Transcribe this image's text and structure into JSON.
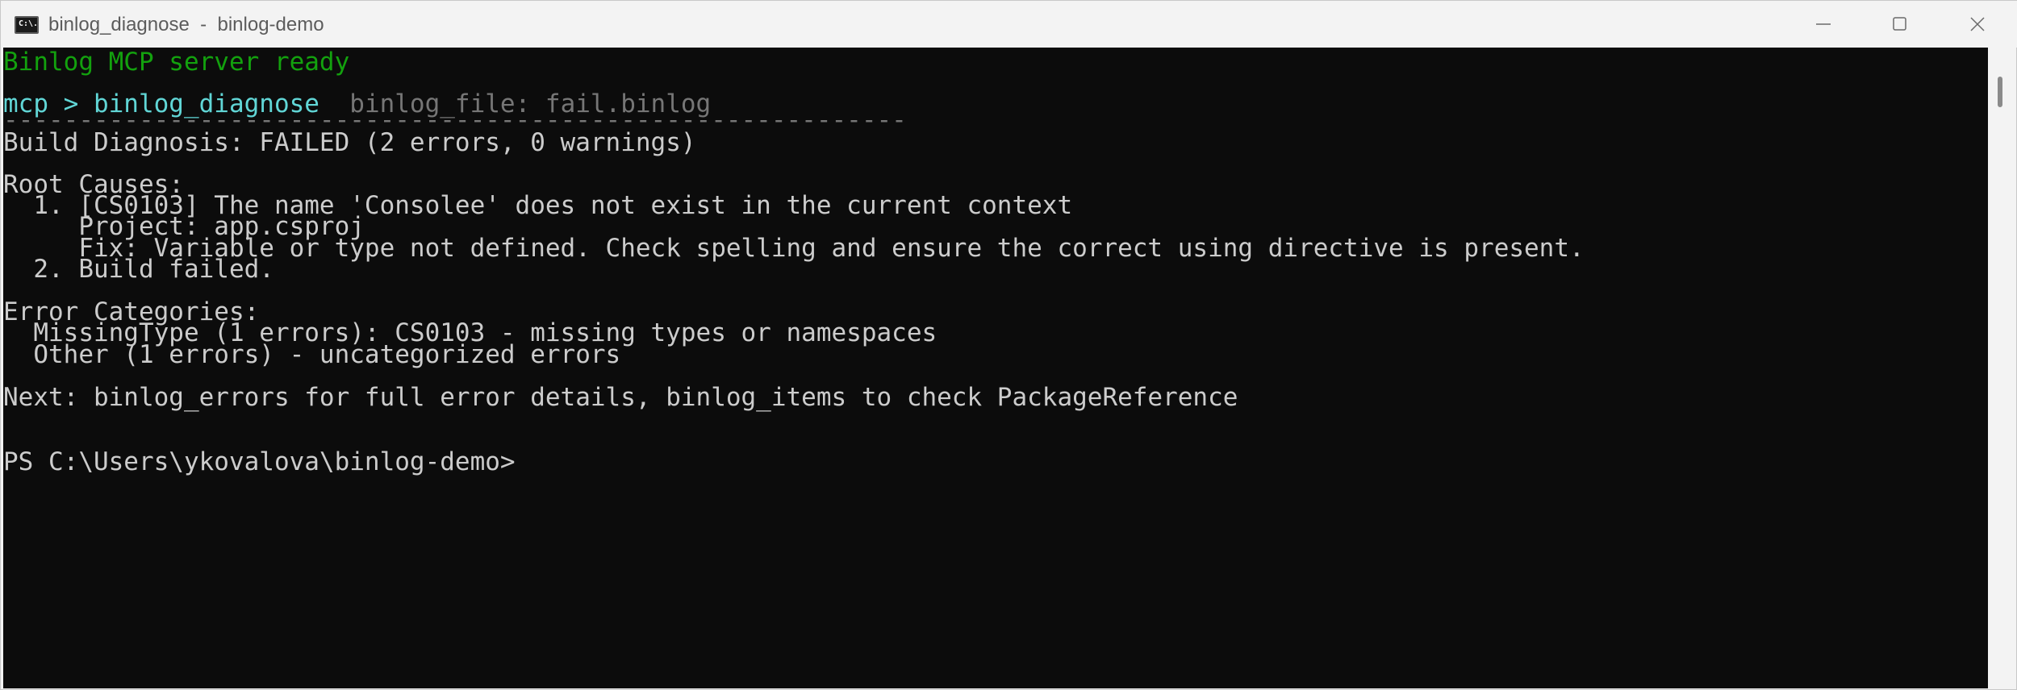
{
  "window": {
    "title": "binlog_diagnose  -  binlog-demo",
    "icon_text": "C:\\."
  },
  "terminal": {
    "ready_line": "Binlog MCP server ready",
    "prompt": "mcp > ",
    "command": "binlog_diagnose",
    "argument": "  binlog_file: fail.binlog",
    "separator": "------------------------------------------------------------",
    "summary": "Build Diagnosis: FAILED (2 errors, 0 warnings)",
    "root_causes_header": "Root Causes:",
    "root_causes": [
      "  1. [CS0103] The name 'Consolee' does not exist in the current context",
      "     Project: app.csproj",
      "     Fix: Variable or type not defined. Check spelling and ensure the correct using directive is present.",
      "  2. Build failed."
    ],
    "error_categories_header": "Error Categories:",
    "error_categories": [
      "  MissingType (1 errors): CS0103 - missing types or namespaces",
      "  Other (1 errors) - uncategorized errors"
    ],
    "next_line": "Next: binlog_errors for full error details, binlog_items to check PackageReference",
    "ps_prompt": "PS C:\\Users\\ykovalova\\binlog-demo>"
  },
  "colors": {
    "terminal_bg": "#0c0c0c",
    "text": "#cccccc",
    "green": "#13a10e",
    "cyan": "#61d6d6",
    "gray": "#767676"
  }
}
